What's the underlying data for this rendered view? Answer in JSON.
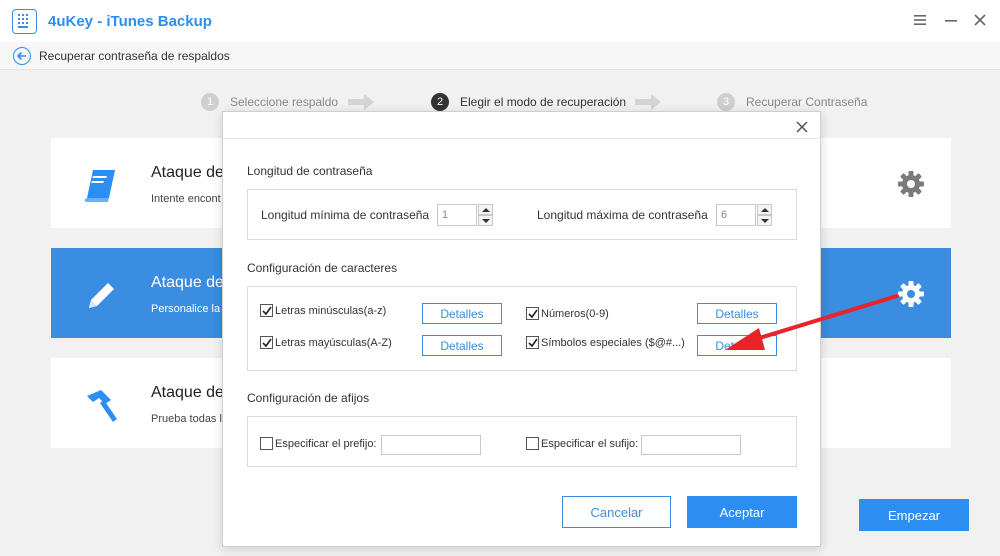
{
  "app": {
    "title": "4uKey - iTunes Backup",
    "accent_color": "#2b8ef0"
  },
  "window_controls": [
    "menu-icon",
    "minimize-icon",
    "close-icon"
  ],
  "subheader": {
    "title": "Recuperar contraseña de respaldos",
    "back_icon": "back-arrow-icon"
  },
  "steps": [
    {
      "number": "1",
      "label": "Seleccione respaldo",
      "active": false
    },
    {
      "number": "2",
      "label": "Elegir el modo de recuperación",
      "active": true
    },
    {
      "number": "3",
      "label": "Recuperar Contraseña",
      "active": false
    }
  ],
  "cards": [
    {
      "title": "Ataque de",
      "description": "Intente encont",
      "icon": "book-icon",
      "selected": false,
      "has_gear": true
    },
    {
      "title": "Ataque de",
      "description": "Personalice la c",
      "icon": "pencil-icon",
      "selected": true,
      "has_gear": true
    },
    {
      "title": "Ataque de",
      "description": "Prueba todas la",
      "icon": "hammer-icon",
      "selected": false,
      "has_gear": false
    }
  ],
  "start_button": "Empezar",
  "dialog": {
    "length_section": {
      "title": "Longitud de contraseña",
      "min_label": "Longitud mínima de contraseña",
      "min_value": "1",
      "max_label": "Longitud máxima de contraseña",
      "max_value": "6"
    },
    "charset_section": {
      "title": "Configuración de caracteres",
      "options": [
        {
          "label": "Letras minúsculas(a-z)",
          "checked": true,
          "details": "Detalles"
        },
        {
          "label": "Números(0-9)",
          "checked": true,
          "details": "Detalles"
        },
        {
          "label": "Letras mayúsculas(A-Z)",
          "checked": true,
          "details": "Detalles"
        },
        {
          "label": "Símbolos especiales ($@#...)",
          "checked": true,
          "details": "Detalles"
        }
      ]
    },
    "affix_section": {
      "title": "Configuración de afijos",
      "prefix_label": "Especificar el prefijo:",
      "prefix_value": "",
      "suffix_label": "Especificar el sufijo:",
      "suffix_value": ""
    },
    "cancel_label": "Cancelar",
    "ok_label": "Aceptar"
  },
  "annotation": {
    "color": "#e8232a",
    "icon": "red-pointer-arrow"
  }
}
